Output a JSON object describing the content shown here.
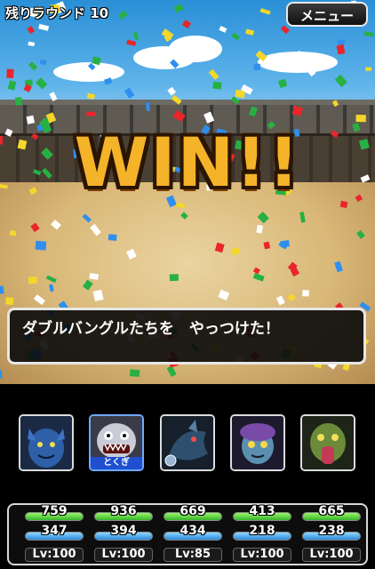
{
  "header": {
    "round_label": "残りラウンド 10",
    "menu_label": "メニュー"
  },
  "battle": {
    "result_title": "WIN!!",
    "message": "ダブルバングルたちを　やっつけた！"
  },
  "colors": {
    "title_gold": "#f5b32a",
    "hp_green": "#36b52a",
    "mp_blue": "#2a86d6",
    "tag_blue": "#1f4fcf"
  },
  "party": [
    {
      "icon": "blue-demon-portrait",
      "tag": "",
      "hp": "759",
      "mp": "347",
      "level": "Lv:100",
      "hp_fill": 1.0,
      "mp_fill": 1.0
    },
    {
      "icon": "silver-monster-portrait",
      "tag": "とくぎ",
      "hp": "936",
      "mp": "394",
      "level": "Lv:100",
      "hp_fill": 1.0,
      "mp_fill": 1.0
    },
    {
      "icon": "dark-dragon-portrait",
      "tag": "",
      "hp": "669",
      "mp": "434",
      "level": "Lv:85",
      "hp_fill": 1.0,
      "mp_fill": 1.0
    },
    {
      "icon": "purple-creature-portrait",
      "tag": "",
      "hp": "413",
      "mp": "218",
      "level": "Lv:100",
      "hp_fill": 1.0,
      "mp_fill": 1.0
    },
    {
      "icon": "green-beast-portrait",
      "tag": "",
      "hp": "665",
      "mp": "238",
      "level": "Lv:100",
      "hp_fill": 1.0,
      "mp_fill": 1.0
    }
  ]
}
